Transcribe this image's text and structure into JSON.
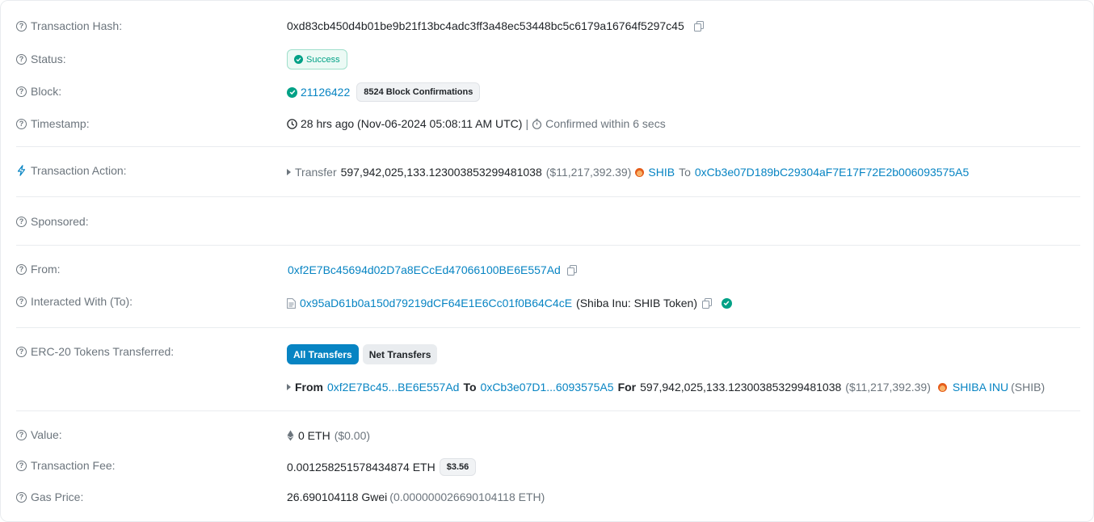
{
  "rows": {
    "tx_hash": {
      "label": "Transaction Hash:",
      "value": "0xd83cb450d4b01be9b21f13bc4adc3ff3a48ec53448bc5c6179a16764f5297c45"
    },
    "status": {
      "label": "Status:",
      "value": "Success"
    },
    "block": {
      "label": "Block:",
      "number": "21126422",
      "confirmations": "8524 Block Confirmations"
    },
    "timestamp": {
      "label": "Timestamp:",
      "value": "28 hrs ago (Nov-06-2024 05:08:11 AM UTC)",
      "separator": "|",
      "confirmed": "Confirmed within 6 secs"
    },
    "action": {
      "label": "Transaction Action:",
      "verb": "Transfer",
      "amount": "597,942,025,133.123003853299481038",
      "usd": "($11,217,392.39)",
      "token": "SHIB",
      "to_word": "To",
      "to_address": "0xCb3e07D189bC29304aF7E17F72E2b006093575A5"
    },
    "sponsored": {
      "label": "Sponsored:"
    },
    "from": {
      "label": "From:",
      "value": "0xf2E7Bc45694d02D7a8ECcEd47066100BE6E557Ad"
    },
    "interacted": {
      "label": "Interacted With (To):",
      "address": "0x95aD61b0a150d79219dCF64E1E6Cc01f0B64C4cE",
      "name": "(Shiba Inu: SHIB Token)"
    },
    "erc20": {
      "label": "ERC-20 Tokens Transferred:",
      "tab_all": "All Transfers",
      "tab_net": "Net Transfers",
      "from_word": "From",
      "from_addr": "0xf2E7Bc45...BE6E557Ad",
      "to_word": "To",
      "to_addr": "0xCb3e07D1...6093575A5",
      "for_word": "For",
      "amount": "597,942,025,133.123003853299481038",
      "usd": "($11,217,392.39)",
      "token_name": "SHIBA INU",
      "token_symbol": "(SHIB)"
    },
    "value": {
      "label": "Value:",
      "amount": "0 ETH",
      "usd": "($0.00)"
    },
    "fee": {
      "label": "Transaction Fee:",
      "amount": "0.001258251578434874 ETH",
      "usd": "$3.56"
    },
    "gas": {
      "label": "Gas Price:",
      "gwei": "26.690104118 Gwei",
      "eth": "(0.000000026690104118 ETH)"
    }
  },
  "colors": {
    "link": "#0784c3",
    "success": "#00a186",
    "muted": "#6c757d"
  },
  "icons": [
    "question-icon",
    "copy-icon",
    "check-circle-icon",
    "clock-icon",
    "stopwatch-icon",
    "lightning-icon",
    "caret-right-icon",
    "shib-token-icon",
    "document-icon",
    "eth-icon"
  ]
}
